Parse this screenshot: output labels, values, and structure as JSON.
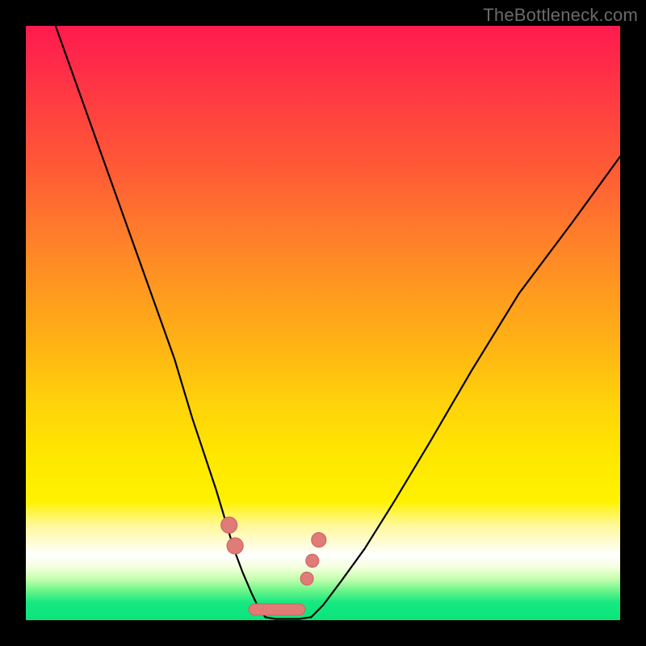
{
  "watermark": "TheBottleneck.com",
  "chart_data": {
    "type": "line",
    "title": "",
    "xlabel": "",
    "ylabel": "",
    "xlim": [
      0,
      100
    ],
    "ylim": [
      0,
      100
    ],
    "series": [
      {
        "name": "left-curve",
        "x": [
          5,
          10,
          15,
          20,
          25,
          28,
          30,
          32,
          33.5,
          35,
          36.5,
          38,
          39.2,
          40.3
        ],
        "y": [
          100,
          86,
          72,
          58,
          44,
          34,
          28,
          22,
          17,
          12,
          8,
          4.5,
          2,
          0.5
        ]
      },
      {
        "name": "valley-floor",
        "x": [
          40.3,
          42,
          44,
          46,
          48
        ],
        "y": [
          0.5,
          0.2,
          0.2,
          0.2,
          0.5
        ]
      },
      {
        "name": "right-curve",
        "x": [
          48,
          50,
          53,
          57,
          62,
          68,
          75,
          83,
          92,
          100
        ],
        "y": [
          0.5,
          2.5,
          6.5,
          12,
          20,
          30,
          42,
          55,
          67,
          78
        ]
      }
    ],
    "markers": [
      {
        "name": "left-upper-dot",
        "x": 34.2,
        "y": 16,
        "r": 10
      },
      {
        "name": "left-lower-dot",
        "x": 35.2,
        "y": 12.5,
        "r": 10
      },
      {
        "name": "right-upper-dot",
        "x": 49.3,
        "y": 13.5,
        "r": 9
      },
      {
        "name": "right-mid-dot",
        "x": 48.2,
        "y": 10,
        "r": 8
      },
      {
        "name": "right-lower-dot",
        "x": 47.3,
        "y": 7,
        "r": 8
      }
    ],
    "valley_sausage": {
      "x0": 37.5,
      "x1": 47,
      "y": 1.8,
      "thickness": 14
    }
  }
}
